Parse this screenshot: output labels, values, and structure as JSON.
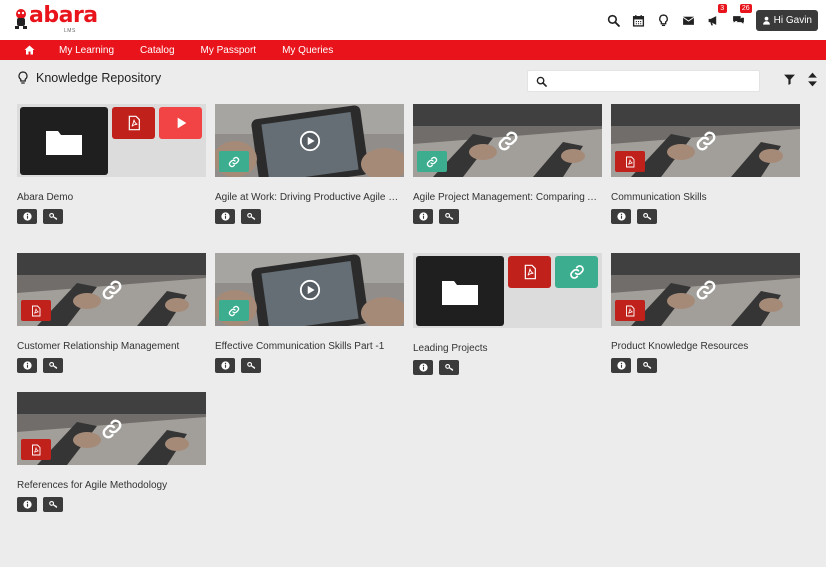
{
  "brand": {
    "name": "abara",
    "sub": "LMS"
  },
  "header": {
    "notifications_count": "3",
    "messages_count": "26",
    "user_label": "Hi Gavin"
  },
  "nav": {
    "items": [
      "My Learning",
      "Catalog",
      "My Passport",
      "My Queries"
    ]
  },
  "page": {
    "title": "Knowledge Repository"
  },
  "search": {
    "placeholder": "",
    "value": ""
  },
  "colors": {
    "brand_red": "#e8131b",
    "pdf_red": "#c0211b",
    "link_green": "#3cae8f",
    "play_red": "#f24444",
    "dark_button": "#3b3b3b"
  },
  "cards": [
    {
      "title": "Abara Demo",
      "kind": "folder"
    },
    {
      "title": "Agile at Work: Driving Productive Agile Me...",
      "kind": "video-link"
    },
    {
      "title": "Agile Project Management: Comparing Ag...",
      "kind": "link-link"
    },
    {
      "title": "Communication Skills",
      "kind": "link-pdf"
    },
    {
      "title": "Customer Relationship Management",
      "kind": "link-pdf"
    },
    {
      "title": "Effective Communication Skills Part -1",
      "kind": "video-link"
    },
    {
      "title": "Leading Projects",
      "kind": "folder"
    },
    {
      "title": "Product Knowledge Resources",
      "kind": "link-pdf"
    },
    {
      "title": "References for Agile Methodology",
      "kind": "link-pdf"
    }
  ]
}
